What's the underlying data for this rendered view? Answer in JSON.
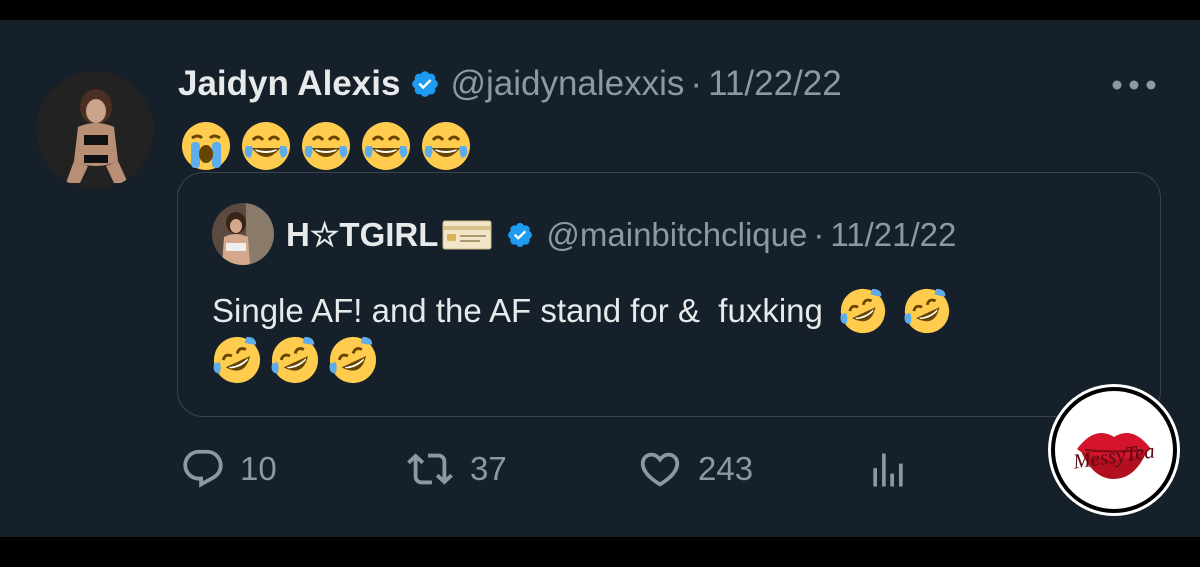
{
  "tweet": {
    "author_name": "Jaidyn Alexis",
    "handle": "@jaidynalexxis",
    "separator": "·",
    "date": "11/22/22",
    "emojis": [
      "loudly-crying-face",
      "tears-of-joy",
      "tears-of-joy",
      "tears-of-joy",
      "tears-of-joy"
    ]
  },
  "quoted": {
    "author_name": "H☆TGIRL",
    "handle": "@mainbitchclique",
    "separator": "·",
    "date": "11/21/22",
    "text": "Single AF! and the AF stand for &  fuxking",
    "line1_emojis": [
      "rolling-on-floor-laughing",
      "rolling-on-floor-laughing"
    ],
    "line2_emojis": [
      "rolling-on-floor-laughing",
      "rolling-on-floor-laughing",
      "rolling-on-floor-laughing"
    ]
  },
  "actions": {
    "replies": "10",
    "retweets": "37",
    "likes": "243"
  },
  "watermark": {
    "text": "MessyTea"
  },
  "colors": {
    "background": "#15202b",
    "border": "#38444d",
    "primary_text": "#e7e9ea",
    "secondary_text": "#8b98a5",
    "verified_blue": "#1d9bf0"
  }
}
